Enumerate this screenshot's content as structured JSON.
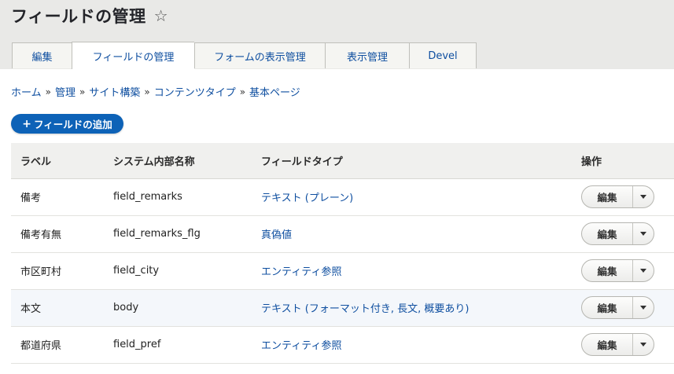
{
  "page": {
    "title": "フィールドの管理"
  },
  "tabs": [
    {
      "label": "編集",
      "active": false
    },
    {
      "label": "フィールドの管理",
      "active": true
    },
    {
      "label": "フォームの表示管理",
      "active": false
    },
    {
      "label": "表示管理",
      "active": false
    },
    {
      "label": "Devel",
      "active": false
    }
  ],
  "breadcrumb": [
    "ホーム",
    "管理",
    "サイト構築",
    "コンテンツタイプ",
    "基本ページ"
  ],
  "breadcrumb_separator": "»",
  "add_button": {
    "plus": "+",
    "label": "フィールドの追加"
  },
  "table": {
    "headers": [
      "ラベル",
      "システム内部名称",
      "フィールドタイプ",
      "操作"
    ],
    "rows": [
      {
        "label": "備考",
        "machine": "field_remarks",
        "type": "テキスト (プレーン)",
        "op": "編集"
      },
      {
        "label": "備考有無",
        "machine": "field_remarks_flg",
        "type": "真偽値",
        "op": "編集"
      },
      {
        "label": "市区町村",
        "machine": "field_city",
        "type": "エンティティ参照",
        "op": "編集"
      },
      {
        "label": "本文",
        "machine": "body",
        "type": "テキスト (フォーマット付き, 長文, 概要あり)",
        "op": "編集"
      },
      {
        "label": "都道府県",
        "machine": "field_pref",
        "type": "エンティティ参照",
        "op": "編集"
      }
    ]
  },
  "colors": {
    "link": "#0f4fa0",
    "primary_button": "#0d62b7",
    "header_bg": "#e9e9e7",
    "highlight_row": "#f4f7fb"
  }
}
